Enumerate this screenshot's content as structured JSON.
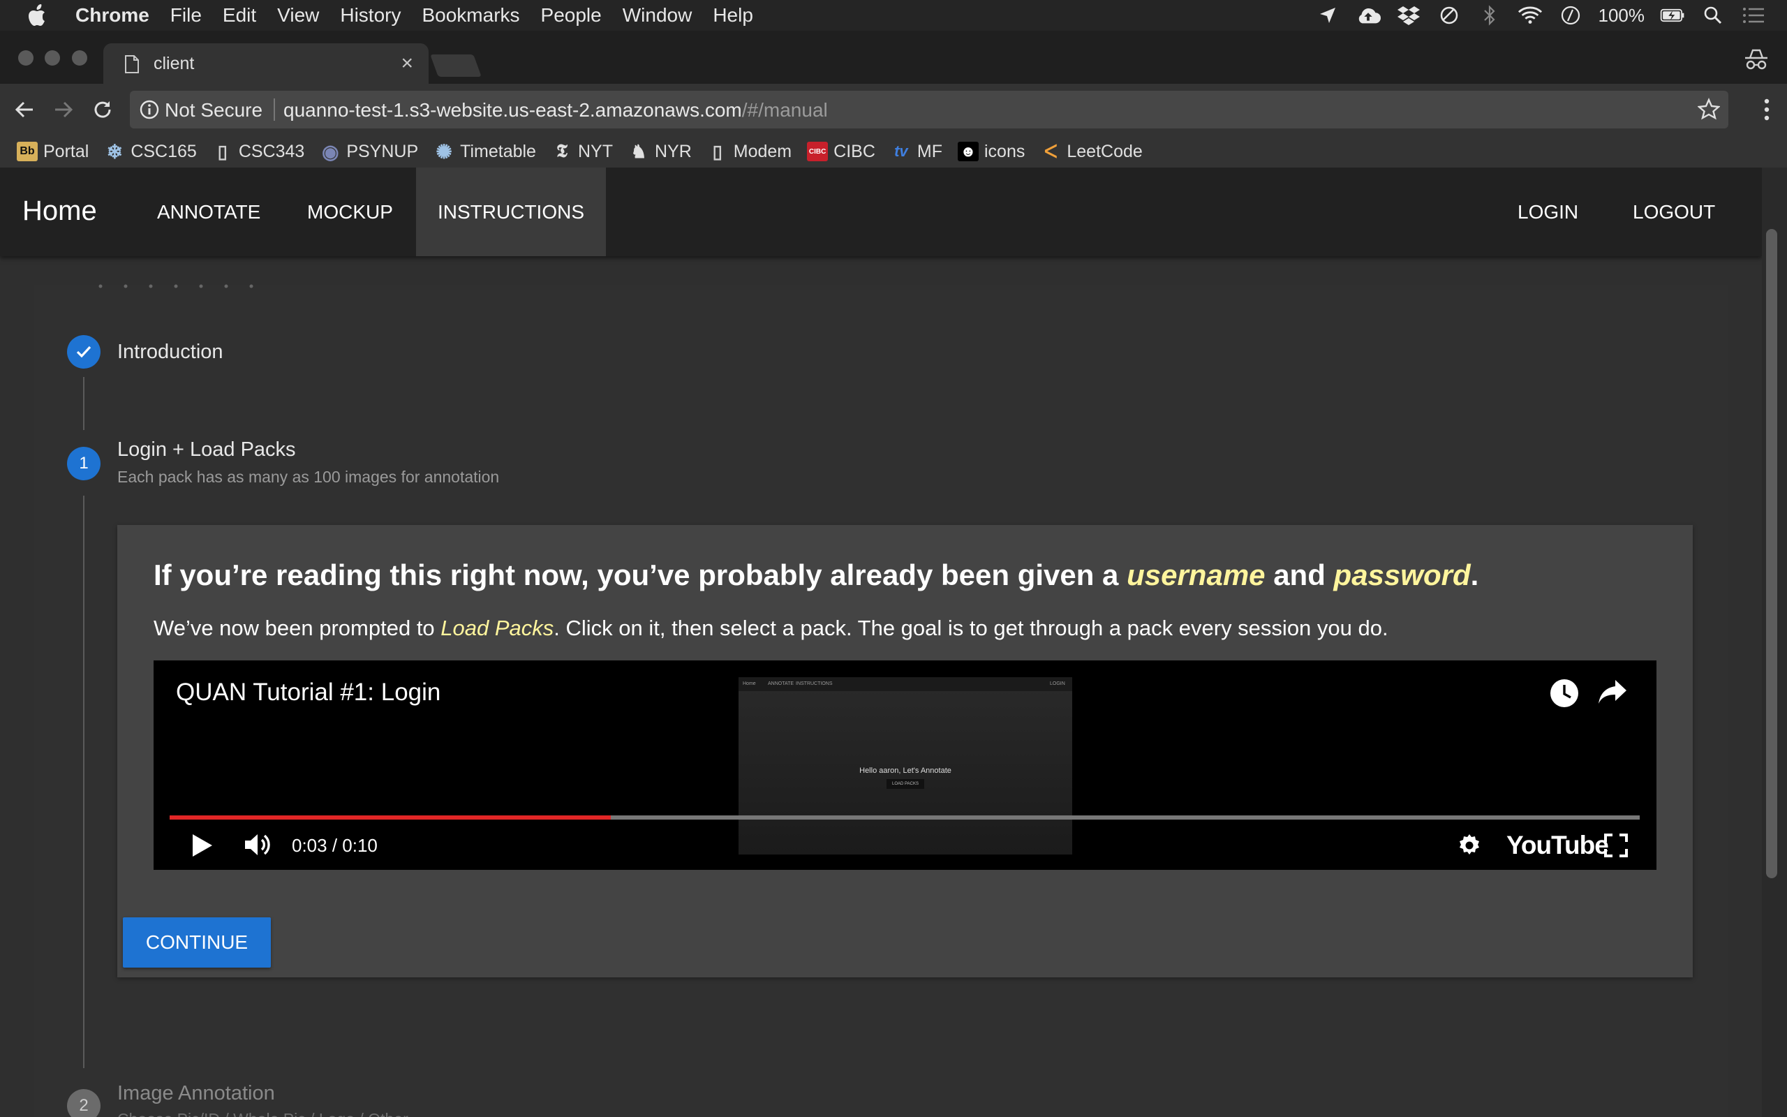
{
  "menubar": {
    "app": "Chrome",
    "items": [
      "File",
      "Edit",
      "View",
      "History",
      "Bookmarks",
      "People",
      "Window",
      "Help"
    ],
    "battery_percent": "100%"
  },
  "browser": {
    "tab_title": "client",
    "tab_close": "×",
    "security_label": "Not Secure",
    "url_host": "quanno-test-1.s3-website.us-east-2.amazonaws.com",
    "url_path": "/#/manual",
    "bookmarks": [
      {
        "label": "Portal",
        "icon": "blackboard-icon",
        "glyph": "Bb",
        "color": "#d7b05a"
      },
      {
        "label": "CSC165",
        "icon": "snowflake-icon",
        "glyph": "❄",
        "color": "#9fc3e6"
      },
      {
        "label": "CSC343",
        "icon": "page-icon",
        "glyph": "▯",
        "color": "#cfcfcf"
      },
      {
        "label": "PSYNUP",
        "icon": "psynup-icon",
        "glyph": "◉",
        "color": "#7b86b5"
      },
      {
        "label": "Timetable",
        "icon": "timetable-icon",
        "glyph": "✺",
        "color": "#9fc3e6"
      },
      {
        "label": "NYT",
        "icon": "nyt-icon",
        "glyph": "𝕿",
        "color": "#e0e0e0"
      },
      {
        "label": "NYR",
        "icon": "nyr-icon",
        "glyph": "♞",
        "color": "#e0e0e0"
      },
      {
        "label": "Modem",
        "icon": "page-icon",
        "glyph": "▯",
        "color": "#cfcfcf"
      },
      {
        "label": "CIBC",
        "icon": "cibc-icon",
        "glyph": "CIBC",
        "color": "#c8202b"
      },
      {
        "label": "MF",
        "icon": "mf-icon",
        "glyph": "tv",
        "color": "#3f7fe0"
      },
      {
        "label": "icons",
        "icon": "icons8-icon",
        "glyph": "☻",
        "color": "#ffffff"
      },
      {
        "label": "LeetCode",
        "icon": "leetcode-icon",
        "glyph": "ᐸ",
        "color": "#f0a03a"
      }
    ]
  },
  "appbar": {
    "brand": "Home",
    "nav": [
      "ANNOTATE",
      "MOCKUP",
      "INSTRUCTIONS"
    ],
    "active_nav": "INSTRUCTIONS",
    "right_nav": [
      "LOGIN",
      "LOGOUT"
    ]
  },
  "steps": [
    {
      "label": "Introduction",
      "status": "completed",
      "badge": "✓"
    },
    {
      "label": "Login + Load Packs",
      "sub": "Each pack has as many as 100 images for annotation",
      "status": "active",
      "badge": "1"
    },
    {
      "label": "Image Annotation",
      "sub": "Choose Pic/ID / Whole Pic / Logo / Other",
      "status": "inactive",
      "badge": "2"
    }
  ],
  "content": {
    "headline_pre": "If you’re reading this right now, you’ve probably already been given a ",
    "headline_em1": "username",
    "headline_mid": " and ",
    "headline_em2": "password",
    "headline_post": ".",
    "sub_pre": "We’ve now been prompted to ",
    "sub_em": "Load Packs",
    "sub_post": ". Click on it, then select a pack. The goal is to get through a pack every session you do.",
    "continue_label": "CONTINUE"
  },
  "video": {
    "title": "QUAN Tutorial #1: Login",
    "time": "0:03 / 0:10",
    "progress": 0.3,
    "brand": "YouTube",
    "thumb_nav": [
      "Home",
      "ANNOTATE",
      "INSTRUCTIONS",
      "LOGIN"
    ],
    "thumb_text": "Hello aaron, Let's Annotate",
    "thumb_button": "LOAD PACKS"
  },
  "colors": {
    "accent": "#1e73d2",
    "highlight": "#fff59d",
    "progress_red": "#e12626"
  }
}
